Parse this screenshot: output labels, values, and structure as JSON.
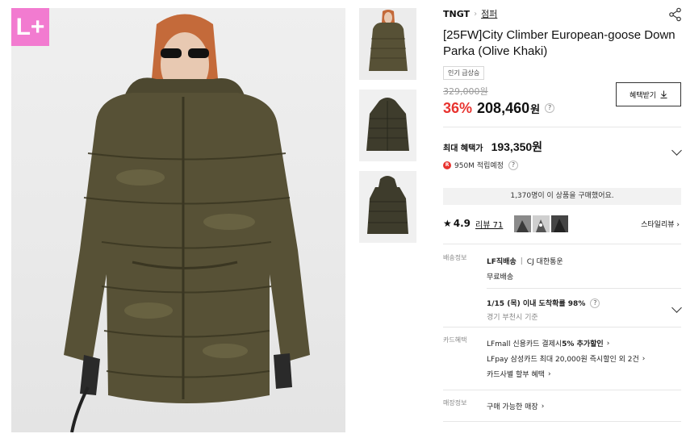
{
  "colors": {
    "accent_red": "#e8332f",
    "badge_pink": "#f27bd0",
    "olive": "#4a4630"
  },
  "badge_logo": "L+",
  "breadcrumb": {
    "brand": "TNGT",
    "separator": "›",
    "category": "점퍼"
  },
  "product": {
    "title": "[25FW]City Climber European-goose Down Parka (Olive Khaki)",
    "tag": "인기 급상승",
    "original_price": "329,000원",
    "discount": "36%",
    "price": "208,460",
    "currency": "원",
    "help_icon": "?"
  },
  "benefit_button": {
    "label": "혜택받기",
    "icon": "download-icon"
  },
  "max_benefit": {
    "label": "최대 혜택가",
    "amount": "193,350원",
    "points": "950M 적립예정",
    "point_icon": "R"
  },
  "buyers_notice": "1,370명이 이 상품을 구매했어요.",
  "reviews": {
    "star": "★",
    "rating": "4.9",
    "review_link": "리뷰 71",
    "styling_link": "스타일리뷰 ›"
  },
  "shipping": {
    "key": "배송정보",
    "method": "LF직배송",
    "divider": "|",
    "courier": "CJ 대한통운",
    "fee": "무료배송",
    "arrival": "1/15 (목) 이내 도착확률 98%",
    "origin": "경기 부천시 기준"
  },
  "card": {
    "key": "카드혜택",
    "lines": [
      {
        "text": "LFmall 신용카드 결제시 ",
        "bold": "5% 추가할인",
        "arrow": "›"
      },
      {
        "text": "LFpay 삼성카드 최대 20,000원 즉시할인 외 2건",
        "bold": "",
        "arrow": "›"
      },
      {
        "text": "카드사별 할부 혜택",
        "bold": "",
        "arrow": "›"
      }
    ]
  },
  "store": {
    "key": "매장정보",
    "link": "구매 가능한 매장",
    "arrow": "›"
  }
}
